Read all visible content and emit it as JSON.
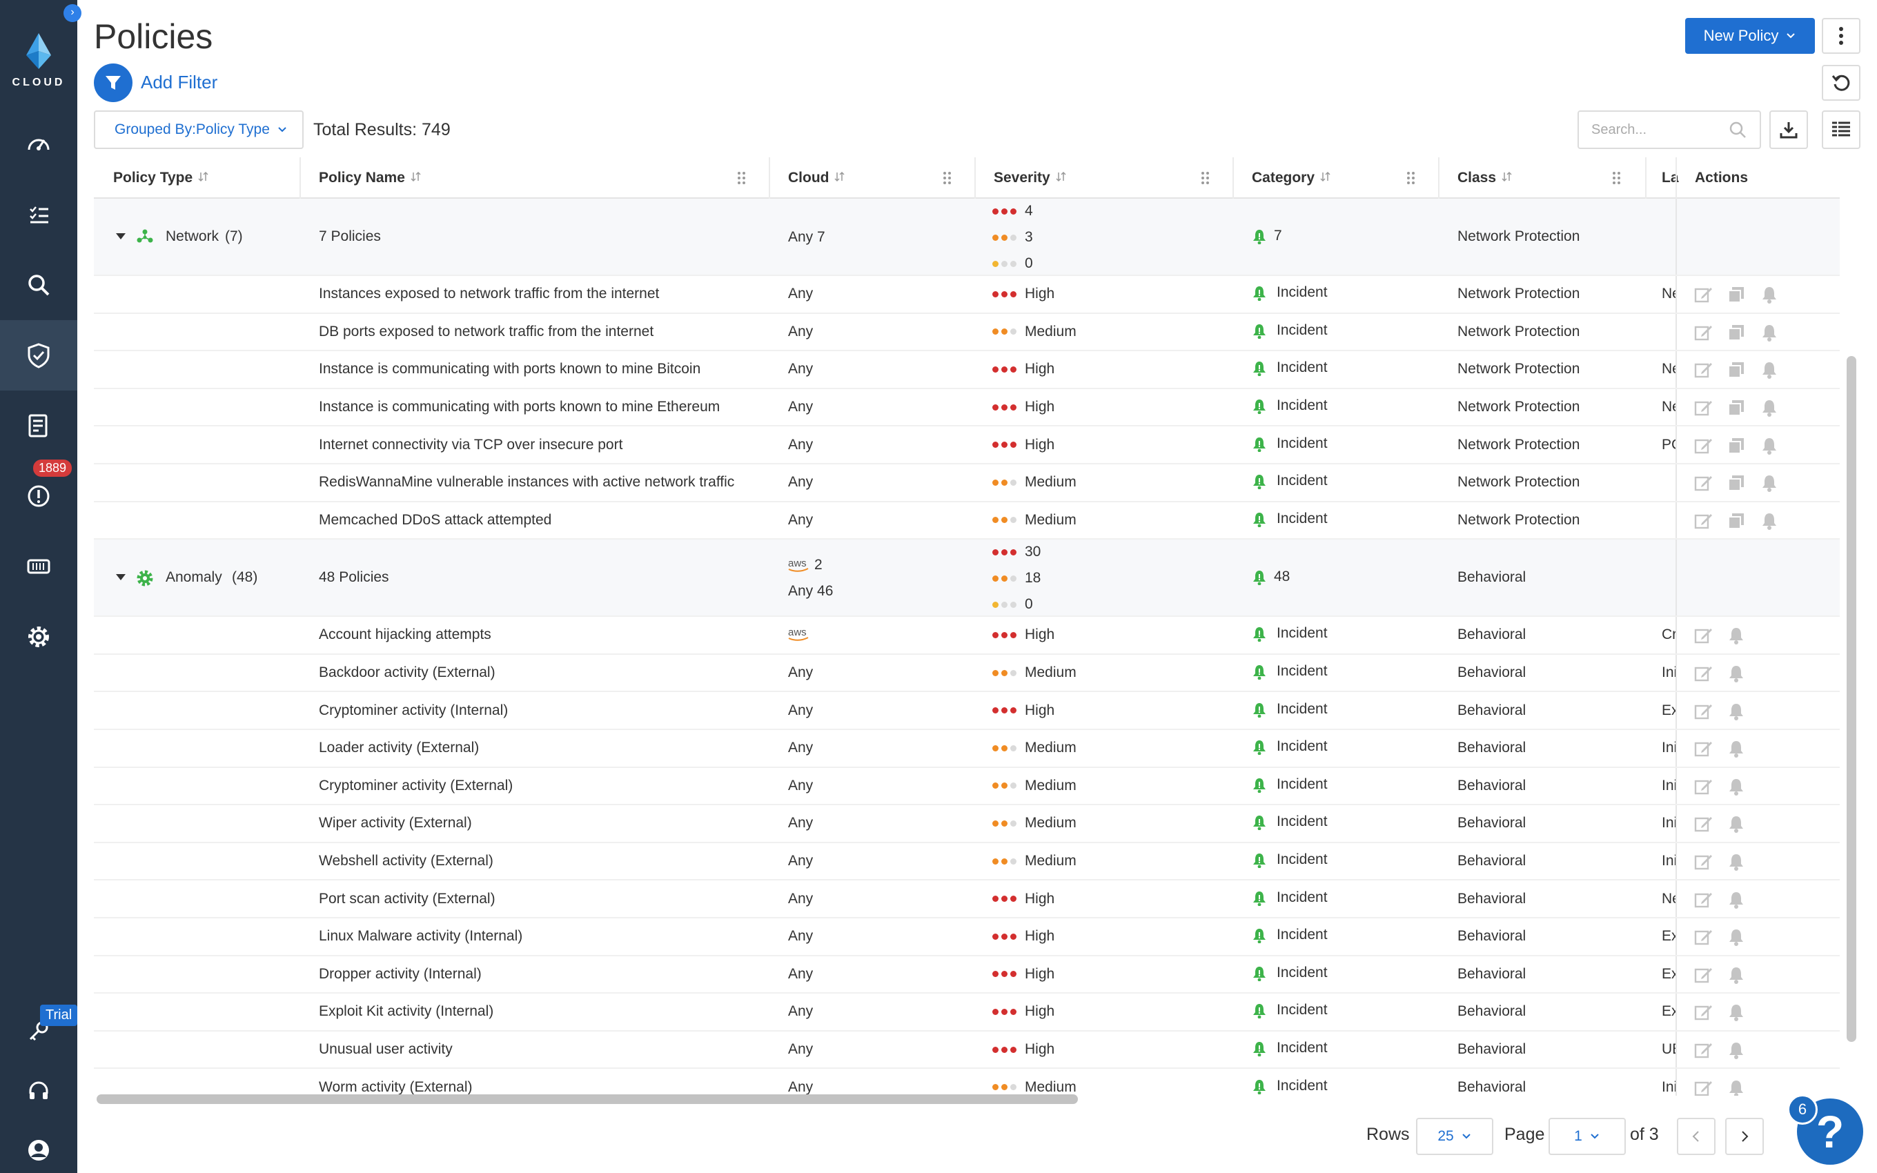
{
  "app": {
    "logo_text": "CLOUD",
    "alerts_badge": "1889",
    "trial_badge": "Trial"
  },
  "header": {
    "title": "Policies",
    "new_policy_label": "New Policy",
    "add_filter_label": "Add Filter",
    "grouped_by_label": "Grouped By:Policy Type",
    "total_results": "Total Results: 749",
    "search_placeholder": "Search..."
  },
  "columns": {
    "policy_type": "Policy Type",
    "policy_name": "Policy Name",
    "cloud": "Cloud",
    "severity": "Severity",
    "category": "Category",
    "class": "Class",
    "labels": "La",
    "actions": "Actions"
  },
  "groups": [
    {
      "name": "Network",
      "count": "(7)",
      "policies": "7 Policies",
      "cloud": [
        {
          "logo": "",
          "text": "Any 7"
        }
      ],
      "sev": [
        "4",
        "3",
        "0"
      ],
      "alerts": "7",
      "class": "Network Protection",
      "rows": [
        {
          "name": "Instances exposed to network traffic from the internet",
          "cloud": "Any",
          "cloud_logo": false,
          "sev": "High",
          "cat": "Incident",
          "class": "Network Protection",
          "label": "Ne",
          "copy": true
        },
        {
          "name": "DB ports exposed to network traffic from the internet",
          "cloud": "Any",
          "cloud_logo": false,
          "sev": "Medium",
          "cat": "Incident",
          "class": "Network Protection",
          "label": "",
          "copy": true
        },
        {
          "name": "Instance is communicating with ports known to mine Bitcoin",
          "cloud": "Any",
          "cloud_logo": false,
          "sev": "High",
          "cat": "Incident",
          "class": "Network Protection",
          "label": "Ne",
          "copy": true
        },
        {
          "name": "Instance is communicating with ports known to mine Ethereum",
          "cloud": "Any",
          "cloud_logo": false,
          "sev": "High",
          "cat": "Incident",
          "class": "Network Protection",
          "label": "Ne",
          "copy": true
        },
        {
          "name": "Internet connectivity via TCP over insecure port",
          "cloud": "Any",
          "cloud_logo": false,
          "sev": "High",
          "cat": "Incident",
          "class": "Network Protection",
          "label": "PC",
          "copy": true
        },
        {
          "name": "RedisWannaMine vulnerable instances with active network traffic",
          "cloud": "Any",
          "cloud_logo": false,
          "sev": "Medium",
          "cat": "Incident",
          "class": "Network Protection",
          "label": "",
          "copy": true
        },
        {
          "name": "Memcached DDoS attack attempted",
          "cloud": "Any",
          "cloud_logo": false,
          "sev": "Medium",
          "cat": "Incident",
          "class": "Network Protection",
          "label": "",
          "copy": true
        }
      ]
    },
    {
      "name": "Anomaly",
      "count": "(48)",
      "policies": "48 Policies",
      "cloud": [
        {
          "logo": "aws",
          "text": "2"
        },
        {
          "logo": "",
          "text": "Any 46"
        }
      ],
      "sev": [
        "30",
        "18",
        "0"
      ],
      "alerts": "48",
      "class": "Behavioral",
      "rows": [
        {
          "name": "Account hijacking attempts",
          "cloud": "",
          "cloud_logo": true,
          "sev": "High",
          "cat": "Incident",
          "class": "Behavioral",
          "label": "Cr",
          "copy": false
        },
        {
          "name": "Backdoor activity (External)",
          "cloud": "Any",
          "cloud_logo": false,
          "sev": "Medium",
          "cat": "Incident",
          "class": "Behavioral",
          "label": "Ini",
          "copy": false
        },
        {
          "name": "Cryptominer activity (Internal)",
          "cloud": "Any",
          "cloud_logo": false,
          "sev": "High",
          "cat": "Incident",
          "class": "Behavioral",
          "label": "Ex",
          "copy": false
        },
        {
          "name": "Loader activity (External)",
          "cloud": "Any",
          "cloud_logo": false,
          "sev": "Medium",
          "cat": "Incident",
          "class": "Behavioral",
          "label": "Ini",
          "copy": false
        },
        {
          "name": "Cryptominer activity (External)",
          "cloud": "Any",
          "cloud_logo": false,
          "sev": "Medium",
          "cat": "Incident",
          "class": "Behavioral",
          "label": "Ini",
          "copy": false
        },
        {
          "name": "Wiper activity (External)",
          "cloud": "Any",
          "cloud_logo": false,
          "sev": "Medium",
          "cat": "Incident",
          "class": "Behavioral",
          "label": "Ini",
          "copy": false
        },
        {
          "name": "Webshell activity (External)",
          "cloud": "Any",
          "cloud_logo": false,
          "sev": "Medium",
          "cat": "Incident",
          "class": "Behavioral",
          "label": "Ini",
          "copy": false
        },
        {
          "name": "Port scan activity (External)",
          "cloud": "Any",
          "cloud_logo": false,
          "sev": "High",
          "cat": "Incident",
          "class": "Behavioral",
          "label": "Ne",
          "copy": false
        },
        {
          "name": "Linux Malware activity (Internal)",
          "cloud": "Any",
          "cloud_logo": false,
          "sev": "High",
          "cat": "Incident",
          "class": "Behavioral",
          "label": "Ex",
          "copy": false
        },
        {
          "name": "Dropper activity (Internal)",
          "cloud": "Any",
          "cloud_logo": false,
          "sev": "High",
          "cat": "Incident",
          "class": "Behavioral",
          "label": "Ex",
          "copy": false
        },
        {
          "name": "Exploit Kit activity (Internal)",
          "cloud": "Any",
          "cloud_logo": false,
          "sev": "High",
          "cat": "Incident",
          "class": "Behavioral",
          "label": "Ex",
          "copy": false
        },
        {
          "name": "Unusual user activity",
          "cloud": "Any",
          "cloud_logo": false,
          "sev": "High",
          "cat": "Incident",
          "class": "Behavioral",
          "label": "UE",
          "copy": false
        },
        {
          "name": "Worm activity (External)",
          "cloud": "Any",
          "cloud_logo": false,
          "sev": "Medium",
          "cat": "Incident",
          "class": "Behavioral",
          "label": "Ini",
          "copy": false
        }
      ]
    }
  ],
  "pagination": {
    "rows_label": "Rows",
    "rows_value": "25",
    "page_label": "Page",
    "page_value": "1",
    "of_label": "of 3"
  },
  "help": {
    "badge": "6",
    "glyph": "?"
  },
  "colors": {
    "accent": "#1f6fd1",
    "sidebar": "#253446",
    "high": "#d32f2f",
    "medium": "#f08c24",
    "low": "#f2b632",
    "incident": "#3db34a"
  }
}
